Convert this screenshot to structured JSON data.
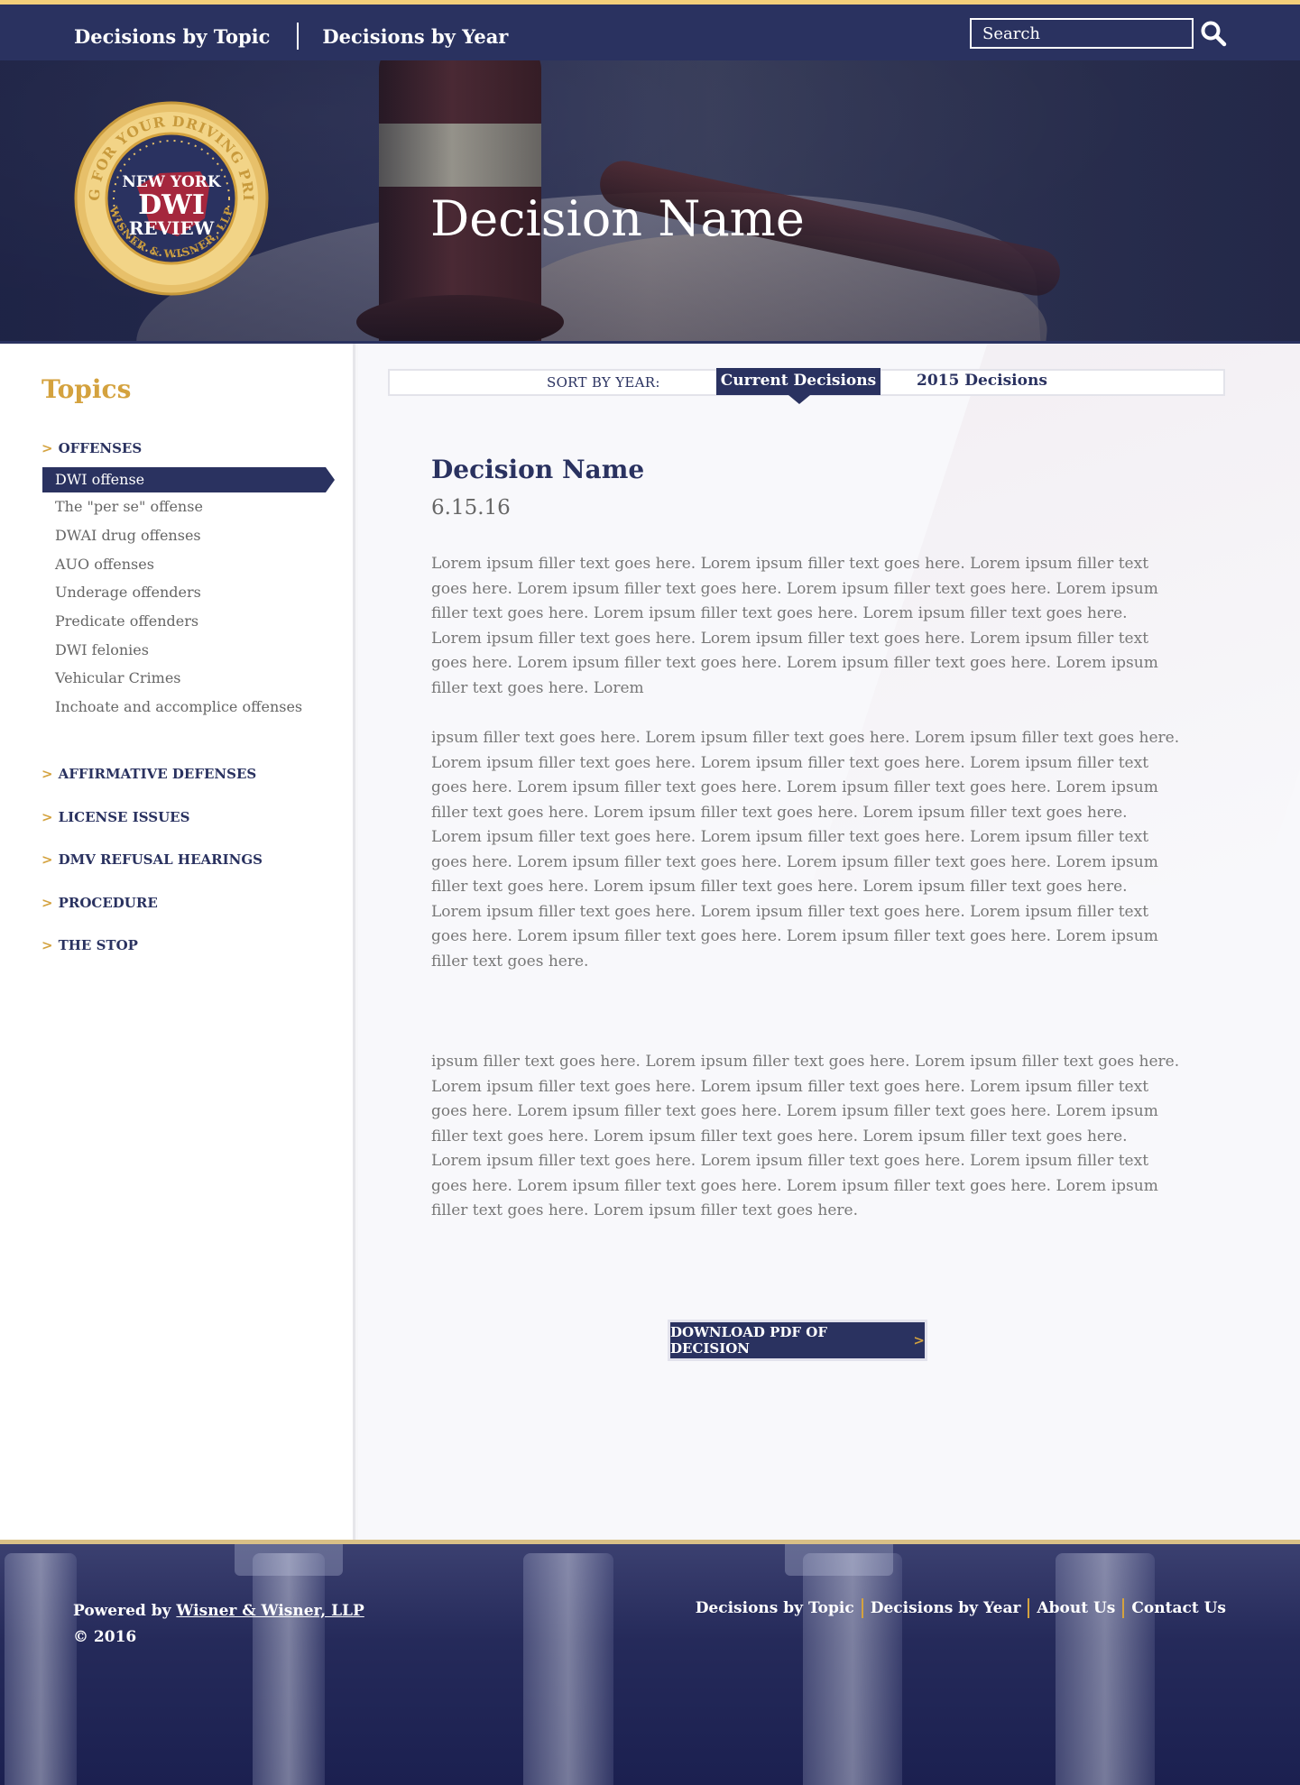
{
  "header": {
    "nav": [
      "Decisions by Topic",
      "Decisions by Year"
    ],
    "search_placeholder": "Search"
  },
  "hero": {
    "title": "Decision Name",
    "logo": {
      "top": "NEW YORK",
      "middle": "DWI",
      "bottom": "REVIEW",
      "ring_text": "FIGHTING FOR YOUR DRIVING PRIVILEGES",
      "ring_bottom": "WISNER & WISNER, LLP"
    }
  },
  "sidebar": {
    "title": "Topics",
    "categories": [
      {
        "label": "OFFENSES"
      },
      {
        "label": "AFFIRMATIVE DEFENSES"
      },
      {
        "label": "LICENSE ISSUES"
      },
      {
        "label": "DMV REFUSAL HEARINGS"
      },
      {
        "label": "PROCEDURE"
      },
      {
        "label": "THE STOP"
      }
    ],
    "offense_items": [
      "DWI offense",
      "The \"per se\" offense",
      "DWAI drug offenses",
      "AUO offenses",
      "Underage offenders",
      "Predicate offenders",
      "DWI felonies",
      "Vehicular Crimes",
      "Inchoate and accomplice offenses"
    ],
    "chevron": ">"
  },
  "sort": {
    "label": "SORT BY YEAR:",
    "current": "Current Decisions",
    "other": "2015 Decisions"
  },
  "decision": {
    "title": "Decision Name",
    "date": "6.15.16",
    "paragraphs": [
      "Lorem ipsum filler text goes here. Lorem ipsum filler text goes here. Lorem ipsum filler text goes here. Lorem ipsum filler text goes here. Lorem ipsum filler text goes here. Lorem ipsum filler text goes here. Lorem ipsum filler text goes here. Lorem ipsum filler text goes here. Lorem ipsum filler text goes here. Lorem ipsum filler text goes here. Lorem ipsum filler text goes here. Lorem ipsum filler text goes here. Lorem ipsum filler text goes here. Lorem ipsum filler text goes here. Lorem",
      "ipsum filler text goes here. Lorem ipsum filler text goes here. Lorem ipsum filler text goes here. Lorem ipsum filler text goes here. Lorem ipsum filler text goes here. Lorem ipsum filler text goes here. Lorem ipsum filler text goes here. Lorem ipsum filler text goes here. Lorem ipsum filler text goes here. Lorem ipsum filler text goes here. Lorem ipsum filler text goes here. Lorem ipsum filler text goes here. Lorem ipsum filler text goes here. Lorem ipsum filler text goes here. Lorem ipsum filler text goes here. Lorem ipsum filler text goes here. Lorem ipsum filler text goes here. Lorem ipsum filler text goes here. Lorem ipsum filler text goes here. Lorem ipsum filler text goes here. Lorem ipsum filler text goes here. Lorem ipsum filler text goes here. Lorem ipsum filler text goes here. Lorem ipsum filler text goes here. Lorem ipsum filler text goes here.",
      "ipsum filler text goes here. Lorem ipsum filler text goes here. Lorem ipsum filler text goes here. Lorem ipsum filler text goes here. Lorem ipsum filler text goes here. Lorem ipsum filler text goes here. Lorem ipsum filler text goes here. Lorem ipsum filler text goes here. Lorem ipsum filler text goes here. Lorem ipsum filler text goes here. Lorem ipsum filler text goes here. Lorem ipsum filler text goes here. Lorem ipsum filler text goes here. Lorem ipsum filler text goes here. Lorem ipsum filler text goes here. Lorem ipsum filler text goes here. Lorem ipsum filler text goes here. Lorem ipsum filler text goes here."
    ],
    "download_label": "DOWNLOAD PDF OF DECISION",
    "download_chevron": ">"
  },
  "footer": {
    "powered_prefix": "Powered by",
    "powered_link": "Wisner & Wisner, LLP",
    "copyright": "© 2016",
    "links": [
      "Decisions by Topic",
      "Decisions by Year",
      "About Us",
      "Contact Us"
    ]
  },
  "colors": {
    "navy": "#2a3260",
    "gold": "#d4a23e",
    "light_gold": "#f3cf7a"
  }
}
